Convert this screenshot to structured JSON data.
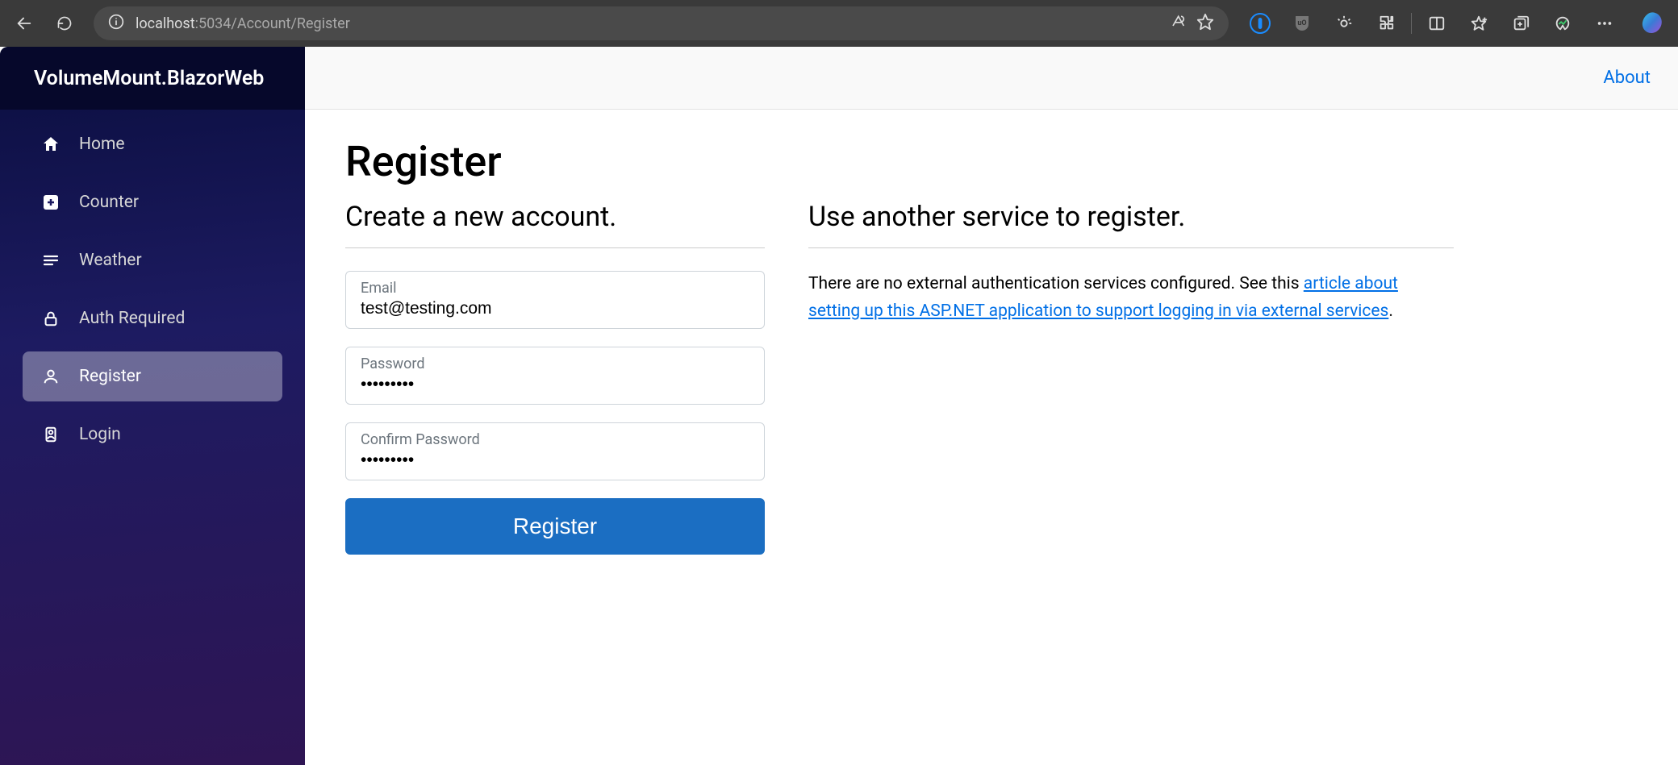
{
  "browser": {
    "url_host": "localhost",
    "url_port_path": ":5034/Account/Register"
  },
  "sidebar": {
    "brand": "VolumeMount.BlazorWeb",
    "items": [
      {
        "label": "Home",
        "icon": "home-icon"
      },
      {
        "label": "Counter",
        "icon": "plus-square-icon"
      },
      {
        "label": "Weather",
        "icon": "list-icon"
      },
      {
        "label": "Auth Required",
        "icon": "lock-icon"
      },
      {
        "label": "Register",
        "icon": "person-icon"
      },
      {
        "label": "Login",
        "icon": "badge-icon"
      }
    ]
  },
  "topbar": {
    "about": "About"
  },
  "page": {
    "title": "Register",
    "left_heading": "Create a new account.",
    "right_heading": "Use another service to register.",
    "email_label": "Email",
    "email_value": "test@testing.com",
    "password_label": "Password",
    "password_value": "•••••••••",
    "confirm_label": "Confirm Password",
    "confirm_value": "•••••••••",
    "submit_label": "Register",
    "external_text_prefix": "There are no external authentication services configured. See this ",
    "external_link_text": "article about setting up this ASP.NET application to support logging in via external services",
    "external_text_suffix": "."
  }
}
